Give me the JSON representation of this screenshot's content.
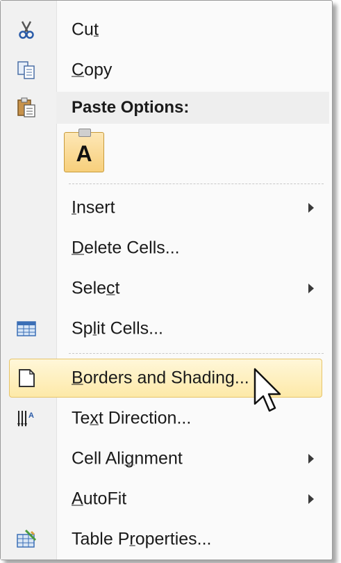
{
  "menu": {
    "items": [
      {
        "id": "cut",
        "label": "Cut",
        "icon": "scissors-icon"
      },
      {
        "id": "copy",
        "label": "Copy",
        "icon": "copy-icon"
      },
      {
        "id": "insert",
        "label": "Insert",
        "submenu": true
      },
      {
        "id": "delete-cells",
        "label": "Delete Cells..."
      },
      {
        "id": "select",
        "label": "Select",
        "submenu": true
      },
      {
        "id": "split-cells",
        "label": "Split Cells...",
        "icon": "split-table-icon"
      },
      {
        "id": "borders-and-shading",
        "label": "Borders and Shading...",
        "icon": "borders-page-icon",
        "highlighted": true
      },
      {
        "id": "text-direction",
        "label": "Text Direction...",
        "icon": "text-direction-icon"
      },
      {
        "id": "cell-alignment",
        "label": "Cell Alignment",
        "submenu": true
      },
      {
        "id": "autofit",
        "label": "AutoFit",
        "submenu": true
      },
      {
        "id": "table-properties",
        "label": "Table Properties...",
        "icon": "table-properties-icon"
      }
    ],
    "paste_options_header": "Paste Options:",
    "paste_keep_text_only_letter": "A",
    "highlight_color": "#fde9a8",
    "highlight_border": "#e6c46a"
  }
}
